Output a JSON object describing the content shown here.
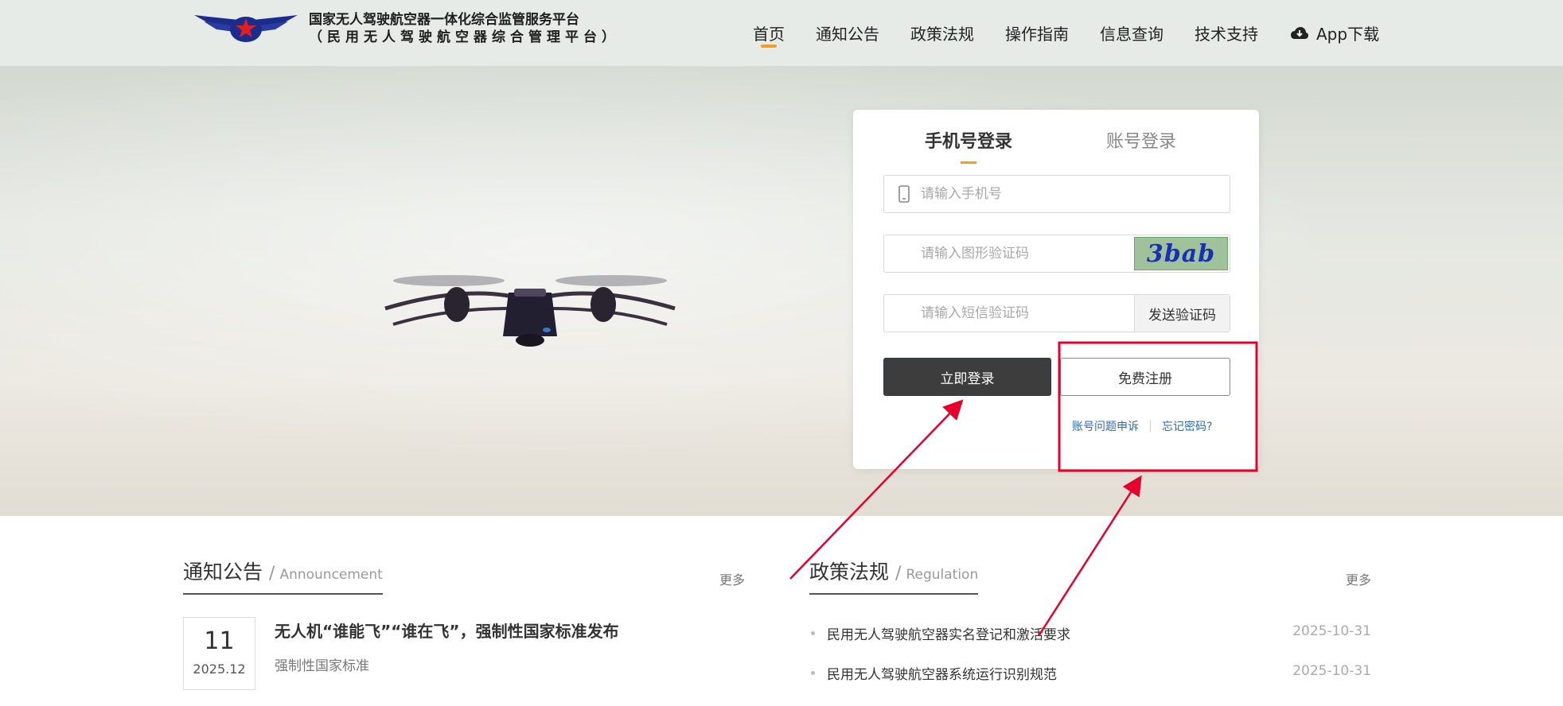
{
  "header": {
    "logo_line1": "国家无人驾驶航空器一体化综合监管服务平台",
    "logo_line2": "（民用无人驾驶航空器综合管理平台）",
    "nav": [
      "首页",
      "通知公告",
      "政策法规",
      "操作指南",
      "信息查询",
      "技术支持"
    ],
    "app_download": "App下载"
  },
  "login": {
    "tab_phone": "手机号登录",
    "tab_account": "账号登录",
    "phone_placeholder": "请输入手机号",
    "captcha_placeholder": "请输入图形验证码",
    "captcha_text": "3bab",
    "sms_placeholder": "请输入短信验证码",
    "send_code": "发送验证码",
    "login_button": "立即登录",
    "register_button": "免费注册",
    "appeal_link": "账号问题申诉",
    "forgot_link": "忘记密码?"
  },
  "announcement": {
    "title": "通知公告",
    "title_en": "Announcement",
    "more": "更多",
    "item": {
      "day": "11",
      "ym": "2025.12",
      "title": "无人机“谁能飞”“谁在飞”，强制性国家标准发布",
      "subtitle": "强制性国家标准"
    }
  },
  "regulation": {
    "title": "政策法规",
    "title_en": "Regulation",
    "more": "更多",
    "items": [
      {
        "title": "民用无人驾驶航空器实名登记和激活要求",
        "date": "2025-10-31"
      },
      {
        "title": "民用无人驾驶航空器系统运行识别规范",
        "date": "2025-10-31"
      }
    ]
  },
  "colors": {
    "accent": "#f0a020",
    "annotation": "#e8002d",
    "link": "#2d6bb8",
    "login_button": "#3d3d3d"
  }
}
